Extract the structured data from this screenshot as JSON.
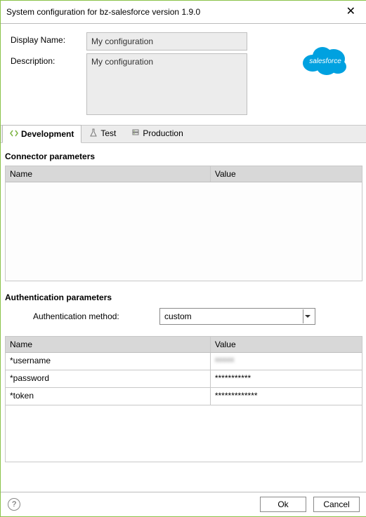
{
  "window": {
    "title": "System configuration for bz-salesforce version 1.9.0"
  },
  "form": {
    "displayName_label": "Display Name:",
    "displayName_value": "My configuration",
    "description_label": "Description:",
    "description_value": "My configuration"
  },
  "brand": {
    "name": "salesforce"
  },
  "tabs": {
    "development": "Development",
    "test": "Test",
    "production": "Production"
  },
  "connector": {
    "title": "Connector parameters",
    "col_name": "Name",
    "col_value": "Value",
    "rows": []
  },
  "auth": {
    "title": "Authentication parameters",
    "method_label": "Authentication method:",
    "method_value": "custom",
    "col_name": "Name",
    "col_value": "Value",
    "rows": [
      {
        "name": "*username",
        "value": "xxxxx"
      },
      {
        "name": "*password",
        "value": "***********"
      },
      {
        "name": "*token",
        "value": "*************"
      }
    ]
  },
  "footer": {
    "ok": "Ok",
    "cancel": "Cancel"
  }
}
